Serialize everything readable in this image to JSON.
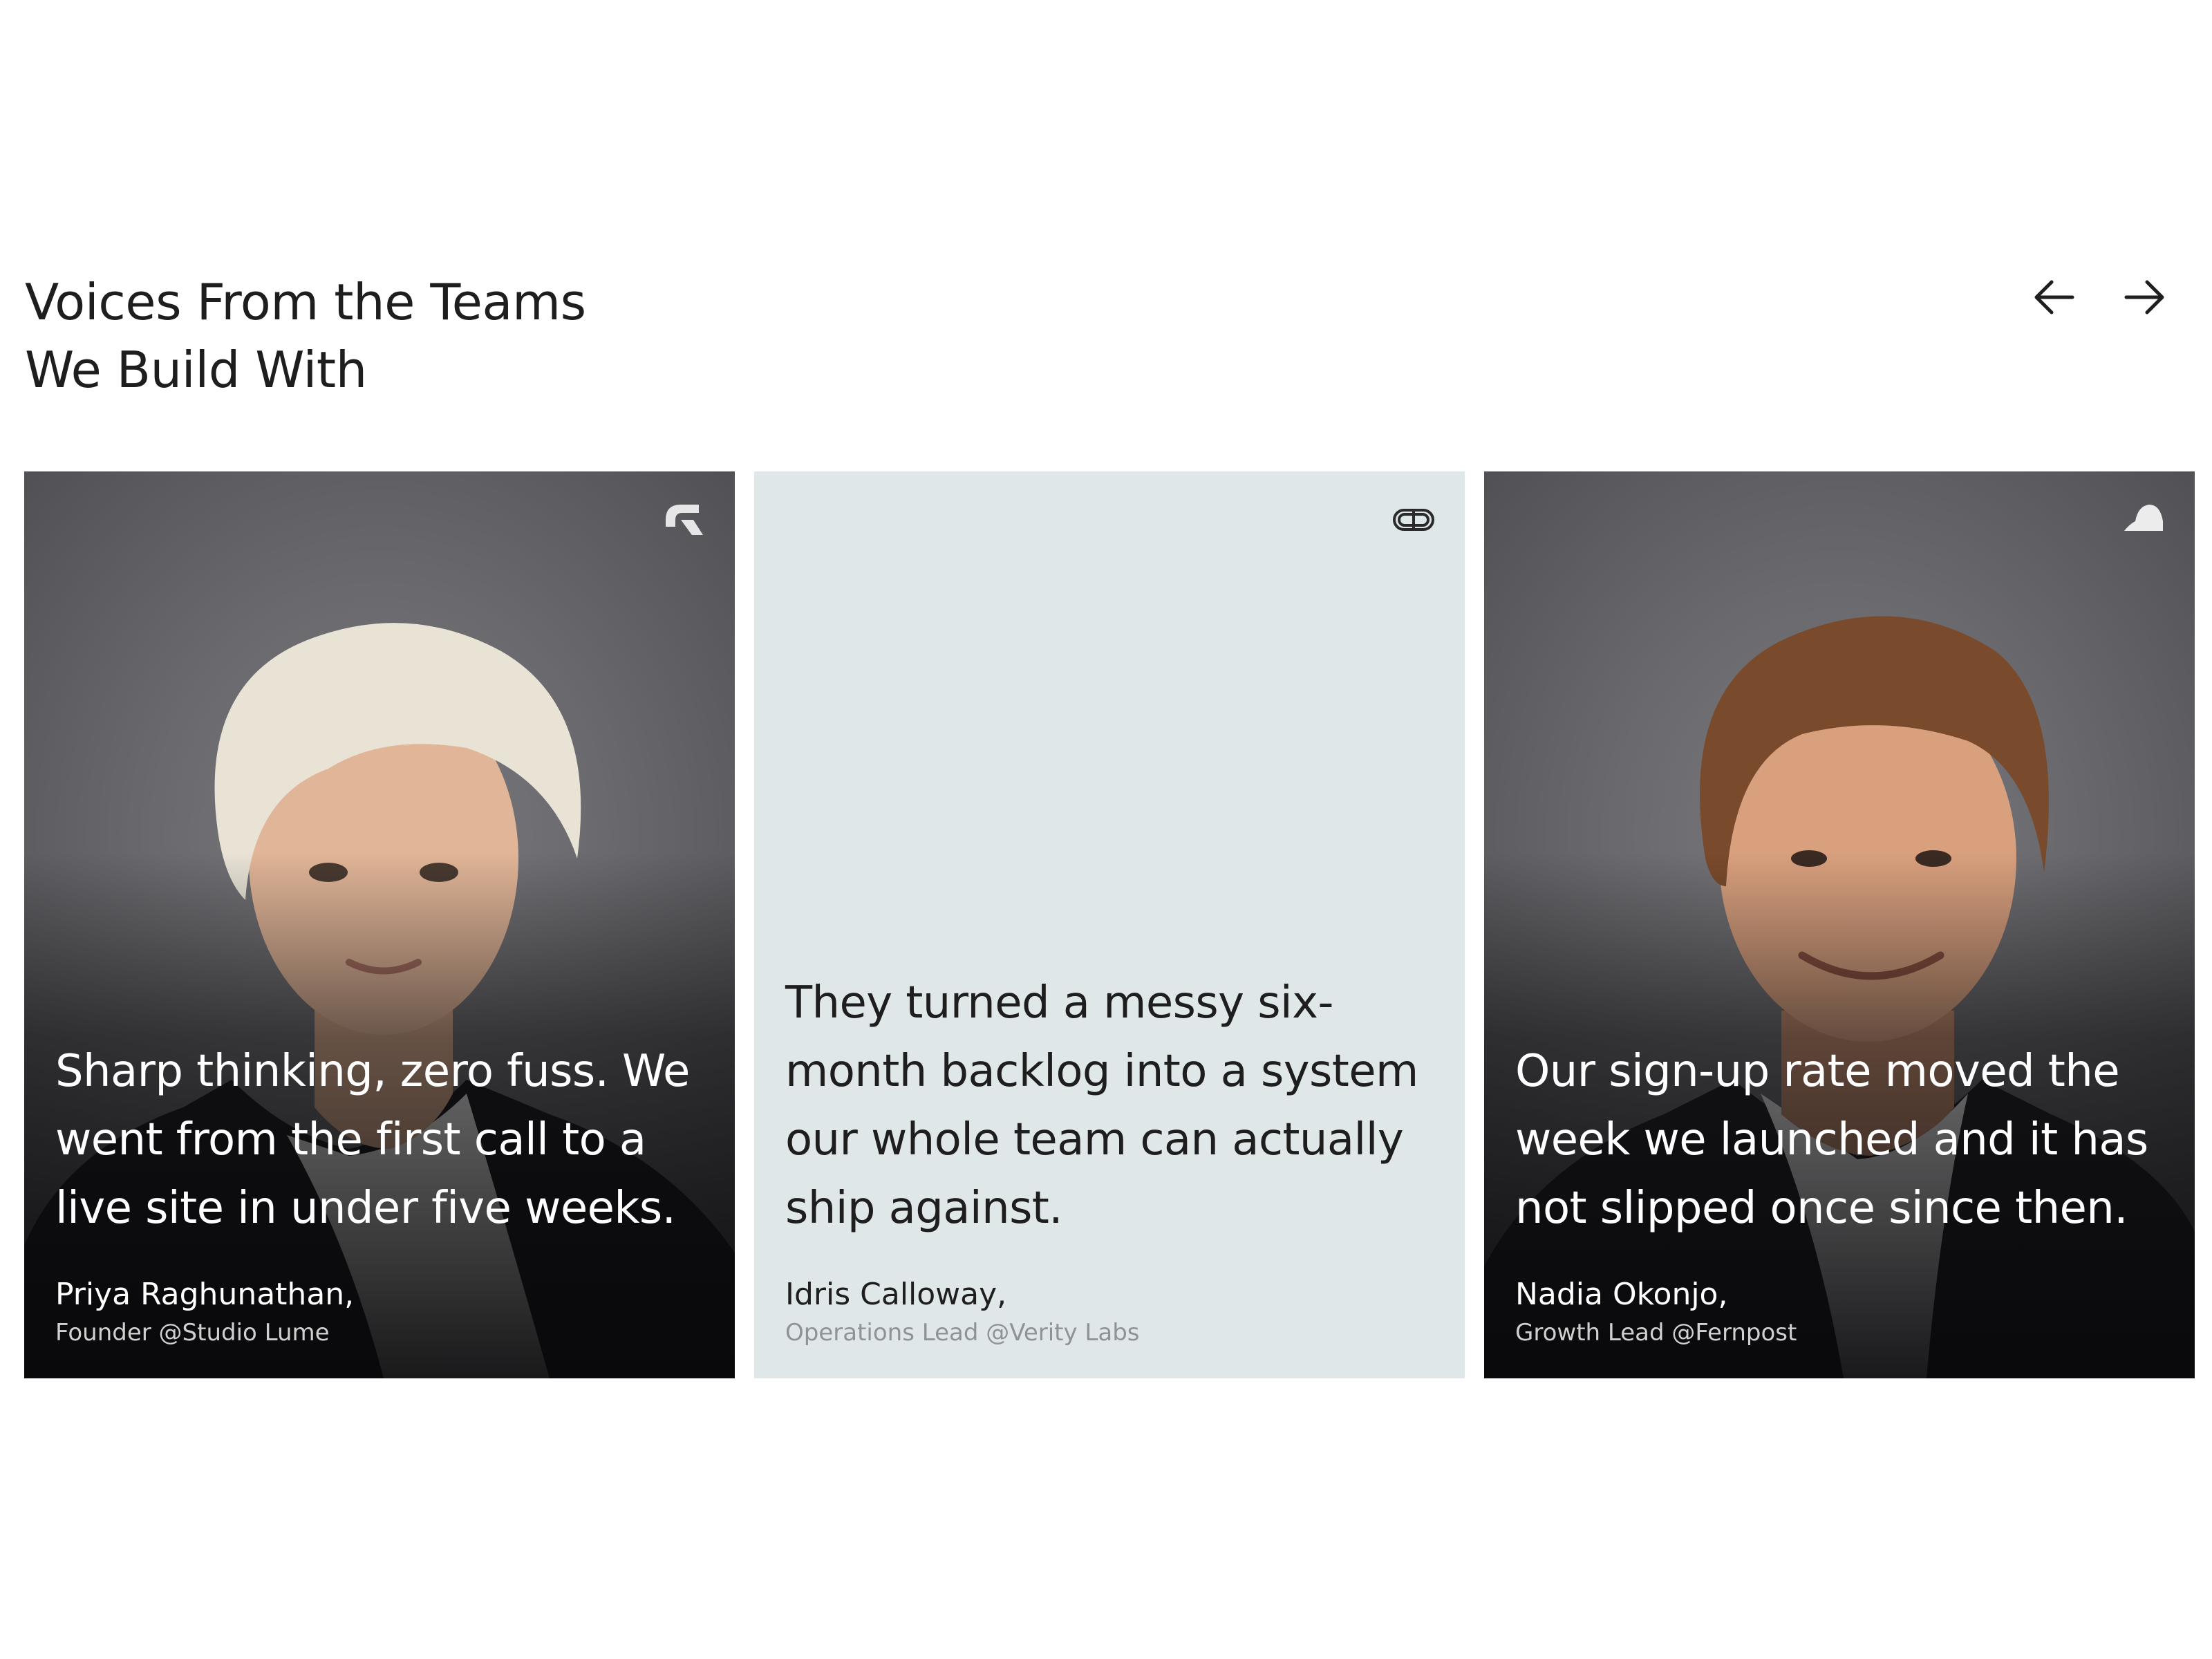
{
  "section": {
    "title_line1": "Voices From the Teams",
    "title_line2": "We Build With"
  },
  "nav": {
    "prev_icon": "arrow-left-icon",
    "next_icon": "arrow-right-icon"
  },
  "colors": {
    "text_dark": "#1e1e1e",
    "plain_card_bg": "#dfe7e8",
    "muted_text": "#8e9496"
  },
  "testimonials": [
    {
      "quote": "Sharp thinking, zero fuss. We went from the first call to a live site in under five weeks.",
      "name": "Priya Raghunathan,",
      "role": "Founder @Studio Lume",
      "logo_icon": "studio-lume-logo-icon",
      "style": "photo"
    },
    {
      "quote": "They turned a messy six-month backlog into a system our whole team can actually ship against.",
      "name": "Idris Calloway,",
      "role": "Operations Lead @Verity Labs",
      "logo_icon": "verity-labs-logo-icon",
      "style": "plain"
    },
    {
      "quote": "Our sign-up rate moved the week we launched and it has not slipped once since then.",
      "name": "Nadia Okonjo,",
      "role": "Growth Lead @Fernpost",
      "logo_icon": "fernpost-logo-icon",
      "style": "photo"
    }
  ]
}
